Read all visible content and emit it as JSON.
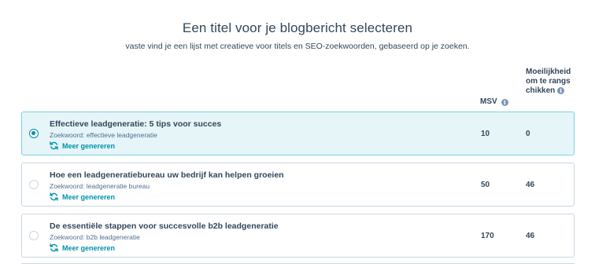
{
  "header": {
    "title": "Een titel voor je blogbericht selecteren",
    "subtitle": "vaste vind je een lijst met creatieve voor titels en SEO-zoekwoorden, gebaseerd op je zoeken."
  },
  "columns": {
    "msv": "MSV",
    "difficulty": "Moeilijkheid om te rangschikken",
    "info_icon": "info-icon"
  },
  "rows": [
    {
      "title": "Effectieve leadgeneratie: 5 tips voor succes",
      "keyword": "Zoekwoord: effectieve leadgeneratie",
      "generate": "Meer genereren",
      "msv": "10",
      "difficulty": "0",
      "selected": true
    },
    {
      "title": "Hoe een leadgeneratiebureau uw bedrijf kan helpen groeien",
      "keyword": "Zoekwoord: leadgeneratie bureau",
      "generate": "Meer genereren",
      "msv": "50",
      "difficulty": "46",
      "selected": false
    },
    {
      "title": "De essentiële stappen voor succesvolle b2b leadgeneratie",
      "keyword": "Zoekwoord: b2b leadgeneratie",
      "generate": "Meer genereren",
      "msv": "170",
      "difficulty": "46",
      "selected": false
    }
  ],
  "colors": {
    "accent": "#0091ae",
    "selected_bg": "#e5f5f8",
    "text": "#33475b"
  }
}
